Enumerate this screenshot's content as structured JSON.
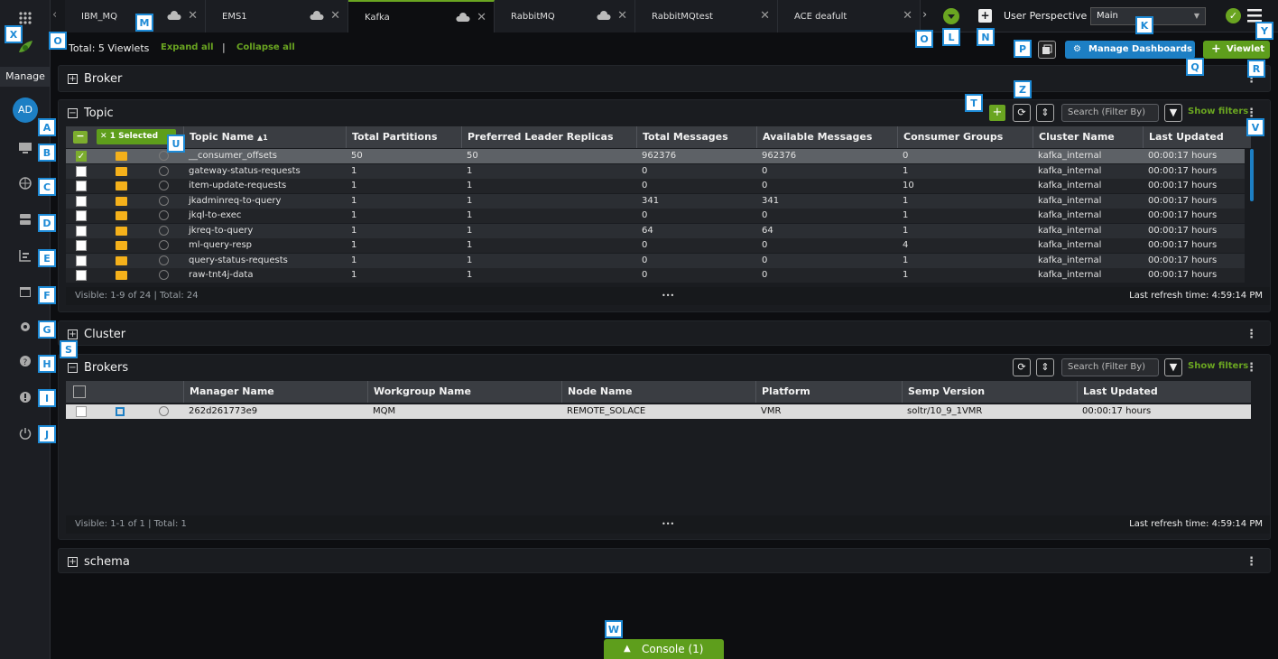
{
  "tabs": [
    {
      "label": "IBM_MQ"
    },
    {
      "label": "EMS1"
    },
    {
      "label": "Kafka"
    },
    {
      "label": "RabbitMQ"
    },
    {
      "label": "RabbitMQtest"
    },
    {
      "label": "ACE deafult"
    }
  ],
  "header": {
    "perspective_label": "User Perspective",
    "perspective_value": "Main"
  },
  "sidebar": {
    "manage_label": "Manage",
    "avatar": "AD"
  },
  "toolbar": {
    "total": "Total: 5 Viewlets",
    "expand": "Expand all",
    "sep": "|",
    "collapse": "Collapse all",
    "manage_dashboards": "Manage Dashboards",
    "viewlet": "Viewlet",
    "viewlet_plus": "+"
  },
  "panels": {
    "broker": "Broker",
    "topic": "Topic",
    "cluster": "Cluster",
    "brokers": "Brokers",
    "schema": "schema"
  },
  "topic": {
    "selected_badge": "1 Selected",
    "search_placeholder": "Search (Filter By)",
    "show_filters": "Show filters",
    "columns": [
      "Topic Name",
      "Total Partitions",
      "Preferred Leader Replicas",
      "Total Messages",
      "Available Messages",
      "Consumer Groups",
      "Cluster Name",
      "Last Updated"
    ],
    "rows": [
      [
        "__consumer_offsets",
        "50",
        "50",
        "962376",
        "962376",
        "0",
        "kafka_internal",
        "00:00:17 hours"
      ],
      [
        "gateway-status-requests",
        "1",
        "1",
        "0",
        "0",
        "1",
        "kafka_internal",
        "00:00:17 hours"
      ],
      [
        "item-update-requests",
        "1",
        "1",
        "0",
        "0",
        "10",
        "kafka_internal",
        "00:00:17 hours"
      ],
      [
        "jkadminreq-to-query",
        "1",
        "1",
        "341",
        "341",
        "1",
        "kafka_internal",
        "00:00:17 hours"
      ],
      [
        "jkql-to-exec",
        "1",
        "1",
        "0",
        "0",
        "1",
        "kafka_internal",
        "00:00:17 hours"
      ],
      [
        "jkreq-to-query",
        "1",
        "1",
        "64",
        "64",
        "1",
        "kafka_internal",
        "00:00:17 hours"
      ],
      [
        "ml-query-resp",
        "1",
        "1",
        "0",
        "0",
        "4",
        "kafka_internal",
        "00:00:17 hours"
      ],
      [
        "query-status-requests",
        "1",
        "1",
        "0",
        "0",
        "1",
        "kafka_internal",
        "00:00:17 hours"
      ],
      [
        "raw-tnt4j-data",
        "1",
        "1",
        "0",
        "0",
        "1",
        "kafka_internal",
        "00:00:17 hours"
      ]
    ],
    "footer_left": "Visible: 1-9 of 24 | Total: 24",
    "footer_right": "Last refresh time: 4:59:14 PM",
    "ellipsis": "•••"
  },
  "brokers": {
    "search_placeholder": "Search (Filter By)",
    "show_filters": "Show filters",
    "columns": [
      "Manager Name",
      "Workgroup Name",
      "Node Name",
      "Platform",
      "Semp Version",
      "Last Updated"
    ],
    "rows": [
      [
        "262d261773e9",
        "MQM",
        "REMOTE_SOLACE",
        "VMR",
        "soltr/10_9_1VMR",
        "00:00:17 hours"
      ]
    ],
    "footer_left": "Visible: 1-1 of 1 | Total: 1",
    "footer_right": "Last refresh time: 4:59:14 PM",
    "ellipsis": "•••"
  },
  "console": {
    "label": "Console (1)"
  },
  "labels": [
    "X",
    "O",
    "M",
    "K",
    "Y",
    "O",
    "L",
    "N",
    "P",
    "Q",
    "R",
    "A",
    "B",
    "C",
    "D",
    "E",
    "F",
    "G",
    "H",
    "I",
    "J",
    "S",
    "T",
    "Z",
    "U",
    "V",
    "W"
  ],
  "colors": {
    "accent": "#6aa521",
    "blue": "#1d7fc4",
    "folder": "#f5b11b"
  }
}
